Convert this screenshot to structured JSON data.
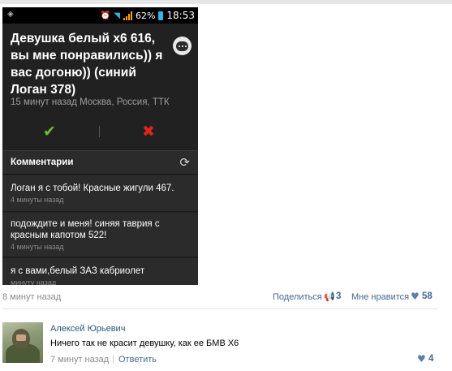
{
  "phone": {
    "status_bar": {
      "battery": "62%",
      "time": "18:53",
      "icons": [
        "sim-icon",
        "alarm-icon",
        "wifi-icon",
        "signal-icon",
        "battery-icon"
      ]
    },
    "post": {
      "title": "Девушка белый х6 616, вы мне понравились)) я вас догоню)) (синий Логан 378)",
      "meta": "15 минут назад Москва, Россия, ТТК"
    },
    "comments_header": "Комментарии",
    "comments": [
      {
        "text": "Логан я с тобой!  Красные жигули 467.",
        "time": "4 минуты назад"
      },
      {
        "text": "подождите и меня! синяя таврия с красным капотом 522!",
        "time": "4 минуты назад"
      },
      {
        "text": "я с вами,белый ЗАЗ кабриолет",
        "time": "минуту назад"
      }
    ],
    "colors": {
      "approve": "#6abf2e",
      "reject": "#e0241c"
    }
  },
  "post_footer": {
    "time": "8 минут назад",
    "share_label": "Поделиться",
    "share_count": "3",
    "like_label": "Мне нравится",
    "like_count": "58"
  },
  "reply": {
    "author": "Алексей Юрьевич",
    "text": "Ничего так не красит девушку, как ее БМВ Х6",
    "time": "7 минут назад",
    "separator": "|",
    "reply_label": "Ответить",
    "like_count": "4"
  },
  "colors": {
    "link": "#45688e",
    "author": "#2b587a",
    "muted": "#8a8a8a"
  }
}
